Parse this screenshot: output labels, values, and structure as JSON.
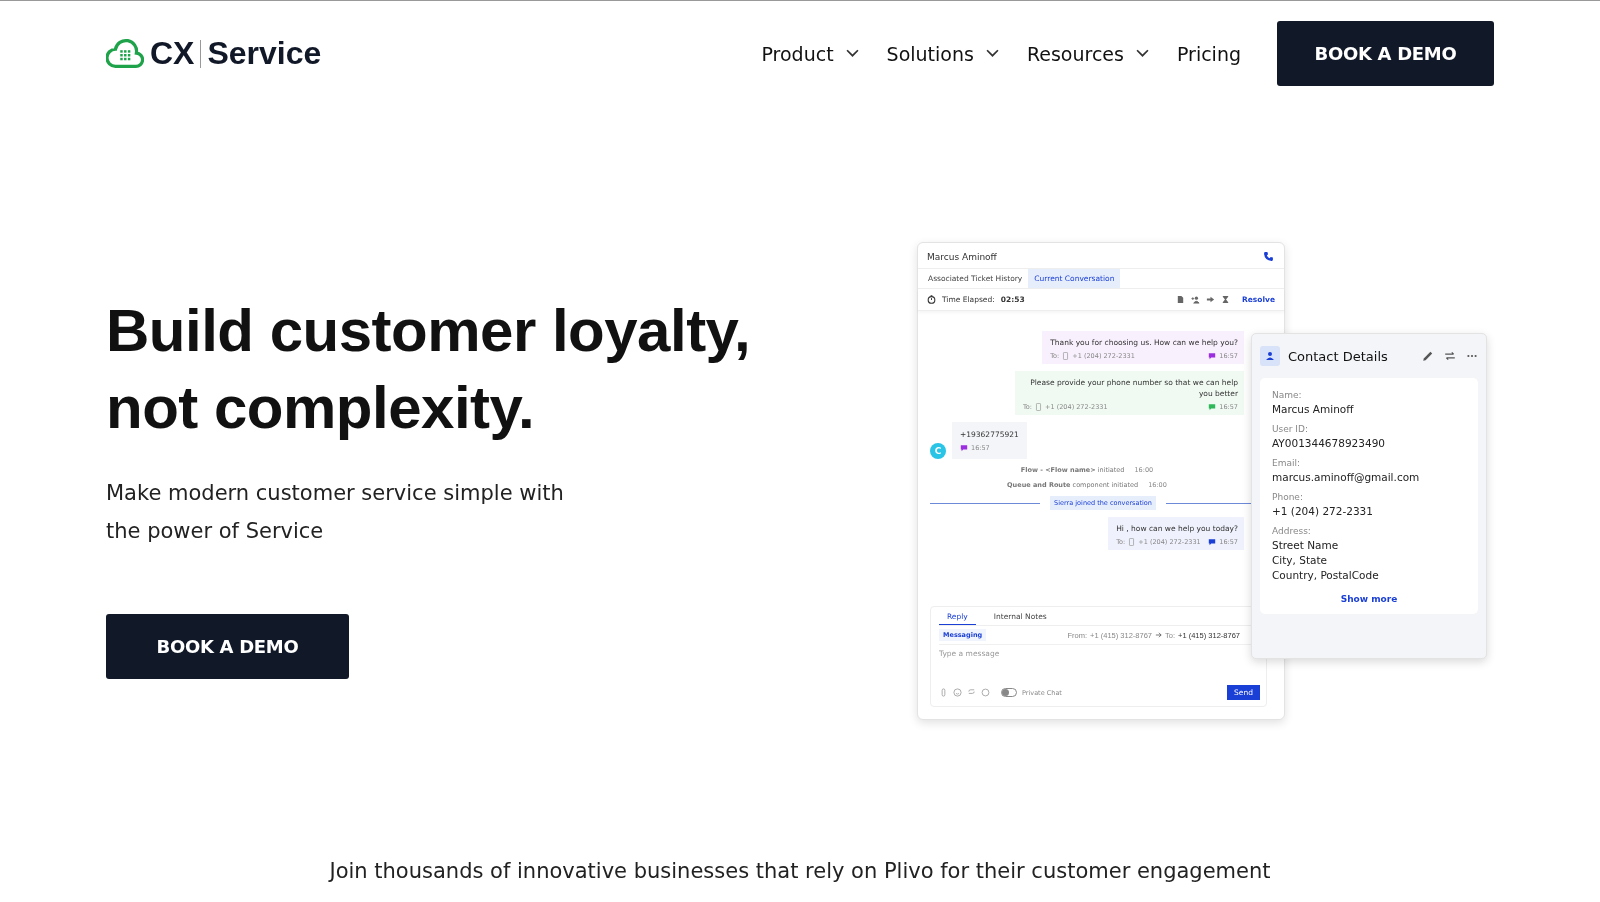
{
  "header": {
    "logo": {
      "brand": "CX",
      "product": "Service"
    },
    "nav": [
      {
        "label": "Product",
        "dropdown": true
      },
      {
        "label": "Solutions",
        "dropdown": true
      },
      {
        "label": "Resources",
        "dropdown": true
      },
      {
        "label": "Pricing",
        "dropdown": false
      }
    ],
    "cta": "BOOK A DEMO"
  },
  "hero": {
    "title_lines": [
      "Build customer loyalty,",
      "not complexity."
    ],
    "subtitle_lines": [
      "Make modern customer service simple with",
      "the power of Service"
    ],
    "button": "BOOK A DEMO"
  },
  "app_preview": {
    "contact_name": "Marcus Aminoff",
    "tabs": [
      {
        "label": "Associated Ticket History",
        "selected": false
      },
      {
        "label": "Current Conversation",
        "selected": true
      }
    ],
    "time_label": "Time Elapsed:",
    "time_value": "02:53",
    "resolve": "Resolve",
    "messages": [
      {
        "kind": "outgoing",
        "text": "Thank you for choosing us. How can we help you?",
        "to_label": "To:",
        "to": "+1 (204) 272-2331",
        "time": "16:57",
        "color": "#9b2fe0"
      },
      {
        "kind": "outgoing",
        "text": "Please provide your phone number so that we can help you better",
        "to_label": "To:",
        "to": "+1 (204) 272-2331",
        "time": "16:57",
        "color": "#2fb85a"
      },
      {
        "kind": "incoming",
        "avatar": "C",
        "text": "+19362775921",
        "time": "16:57",
        "color": "#9b2fe0"
      },
      {
        "kind": "event",
        "text": "**Flow - <Flow name>** initiated",
        "time": "16:00"
      },
      {
        "kind": "event",
        "text": "**Queue and Route** component initiated",
        "time": "16:00"
      },
      {
        "kind": "divider",
        "text": "Sierra joined the conversation"
      },
      {
        "kind": "outgoing",
        "text": "Hi , how can we help you today?",
        "to_label": "To:",
        "to": "+1 (204) 272-2331",
        "time": "16:57",
        "color": "#1a3fd6"
      }
    ],
    "composer": {
      "tabs": [
        {
          "label": "Reply",
          "selected": true
        },
        {
          "label": "Internal Notes",
          "selected": false
        }
      ],
      "channel": "Messaging",
      "from_label": "From:",
      "from": "+1 (415) 312-8767",
      "to_label": "To:",
      "to": "+1 (415) 312-8767",
      "placeholder": "Type a message",
      "private_chat": {
        "label": "Private Chat",
        "on": false
      },
      "send": "Send"
    },
    "contact_card": {
      "title": "Contact Details",
      "fields": [
        {
          "label": "Name:",
          "lines": [
            "Marcus Aminoff"
          ]
        },
        {
          "label": "User ID:",
          "lines": [
            "AY001344678923490"
          ]
        },
        {
          "label": "Email:",
          "lines": [
            "marcus.aminoff@gmail.com"
          ]
        },
        {
          "label": "Phone:",
          "lines": [
            "+1 (204) 272-2331"
          ]
        },
        {
          "label": "Address:",
          "lines": [
            "Street Name",
            "City, State",
            "Country, PostalCode"
          ]
        }
      ],
      "show_more": "Show more"
    }
  },
  "tagline": "Join thousands of innovative businesses that rely on Plivo for their customer engagement"
}
